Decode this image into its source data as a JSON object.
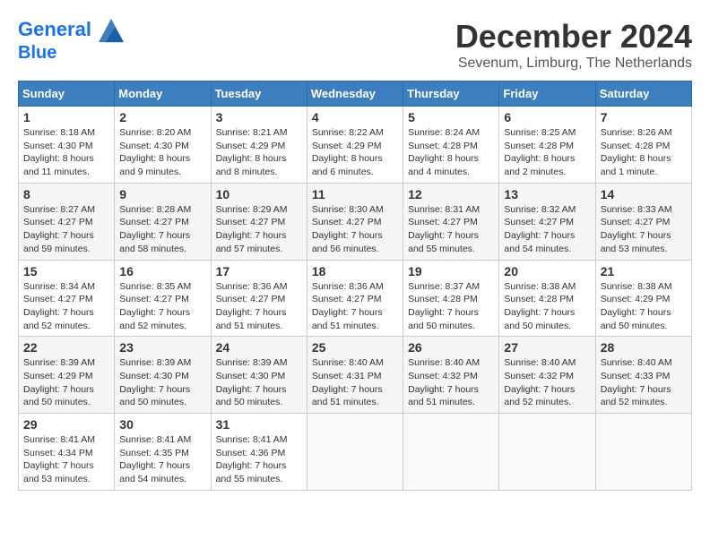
{
  "header": {
    "logo_line1": "General",
    "logo_line2": "Blue",
    "month_title": "December 2024",
    "subtitle": "Sevenum, Limburg, The Netherlands"
  },
  "days_of_week": [
    "Sunday",
    "Monday",
    "Tuesday",
    "Wednesday",
    "Thursday",
    "Friday",
    "Saturday"
  ],
  "weeks": [
    [
      {
        "day": "1",
        "sunrise": "8:18 AM",
        "sunset": "4:30 PM",
        "daylight": "8 hours and 11 minutes."
      },
      {
        "day": "2",
        "sunrise": "8:20 AM",
        "sunset": "4:30 PM",
        "daylight": "8 hours and 9 minutes."
      },
      {
        "day": "3",
        "sunrise": "8:21 AM",
        "sunset": "4:29 PM",
        "daylight": "8 hours and 8 minutes."
      },
      {
        "day": "4",
        "sunrise": "8:22 AM",
        "sunset": "4:29 PM",
        "daylight": "8 hours and 6 minutes."
      },
      {
        "day": "5",
        "sunrise": "8:24 AM",
        "sunset": "4:28 PM",
        "daylight": "8 hours and 4 minutes."
      },
      {
        "day": "6",
        "sunrise": "8:25 AM",
        "sunset": "4:28 PM",
        "daylight": "8 hours and 2 minutes."
      },
      {
        "day": "7",
        "sunrise": "8:26 AM",
        "sunset": "4:28 PM",
        "daylight": "8 hours and 1 minute."
      }
    ],
    [
      {
        "day": "8",
        "sunrise": "8:27 AM",
        "sunset": "4:27 PM",
        "daylight": "7 hours and 59 minutes."
      },
      {
        "day": "9",
        "sunrise": "8:28 AM",
        "sunset": "4:27 PM",
        "daylight": "7 hours and 58 minutes."
      },
      {
        "day": "10",
        "sunrise": "8:29 AM",
        "sunset": "4:27 PM",
        "daylight": "7 hours and 57 minutes."
      },
      {
        "day": "11",
        "sunrise": "8:30 AM",
        "sunset": "4:27 PM",
        "daylight": "7 hours and 56 minutes."
      },
      {
        "day": "12",
        "sunrise": "8:31 AM",
        "sunset": "4:27 PM",
        "daylight": "7 hours and 55 minutes."
      },
      {
        "day": "13",
        "sunrise": "8:32 AM",
        "sunset": "4:27 PM",
        "daylight": "7 hours and 54 minutes."
      },
      {
        "day": "14",
        "sunrise": "8:33 AM",
        "sunset": "4:27 PM",
        "daylight": "7 hours and 53 minutes."
      }
    ],
    [
      {
        "day": "15",
        "sunrise": "8:34 AM",
        "sunset": "4:27 PM",
        "daylight": "7 hours and 52 minutes."
      },
      {
        "day": "16",
        "sunrise": "8:35 AM",
        "sunset": "4:27 PM",
        "daylight": "7 hours and 52 minutes."
      },
      {
        "day": "17",
        "sunrise": "8:36 AM",
        "sunset": "4:27 PM",
        "daylight": "7 hours and 51 minutes."
      },
      {
        "day": "18",
        "sunrise": "8:36 AM",
        "sunset": "4:27 PM",
        "daylight": "7 hours and 51 minutes."
      },
      {
        "day": "19",
        "sunrise": "8:37 AM",
        "sunset": "4:28 PM",
        "daylight": "7 hours and 50 minutes."
      },
      {
        "day": "20",
        "sunrise": "8:38 AM",
        "sunset": "4:28 PM",
        "daylight": "7 hours and 50 minutes."
      },
      {
        "day": "21",
        "sunrise": "8:38 AM",
        "sunset": "4:29 PM",
        "daylight": "7 hours and 50 minutes."
      }
    ],
    [
      {
        "day": "22",
        "sunrise": "8:39 AM",
        "sunset": "4:29 PM",
        "daylight": "7 hours and 50 minutes."
      },
      {
        "day": "23",
        "sunrise": "8:39 AM",
        "sunset": "4:30 PM",
        "daylight": "7 hours and 50 minutes."
      },
      {
        "day": "24",
        "sunrise": "8:39 AM",
        "sunset": "4:30 PM",
        "daylight": "7 hours and 50 minutes."
      },
      {
        "day": "25",
        "sunrise": "8:40 AM",
        "sunset": "4:31 PM",
        "daylight": "7 hours and 51 minutes."
      },
      {
        "day": "26",
        "sunrise": "8:40 AM",
        "sunset": "4:32 PM",
        "daylight": "7 hours and 51 minutes."
      },
      {
        "day": "27",
        "sunrise": "8:40 AM",
        "sunset": "4:32 PM",
        "daylight": "7 hours and 52 minutes."
      },
      {
        "day": "28",
        "sunrise": "8:40 AM",
        "sunset": "4:33 PM",
        "daylight": "7 hours and 52 minutes."
      }
    ],
    [
      {
        "day": "29",
        "sunrise": "8:41 AM",
        "sunset": "4:34 PM",
        "daylight": "7 hours and 53 minutes."
      },
      {
        "day": "30",
        "sunrise": "8:41 AM",
        "sunset": "4:35 PM",
        "daylight": "7 hours and 54 minutes."
      },
      {
        "day": "31",
        "sunrise": "8:41 AM",
        "sunset": "4:36 PM",
        "daylight": "7 hours and 55 minutes."
      },
      null,
      null,
      null,
      null
    ]
  ],
  "labels": {
    "sunrise_label": "Sunrise:",
    "sunset_label": "Sunset:",
    "daylight_label": "Daylight:"
  }
}
